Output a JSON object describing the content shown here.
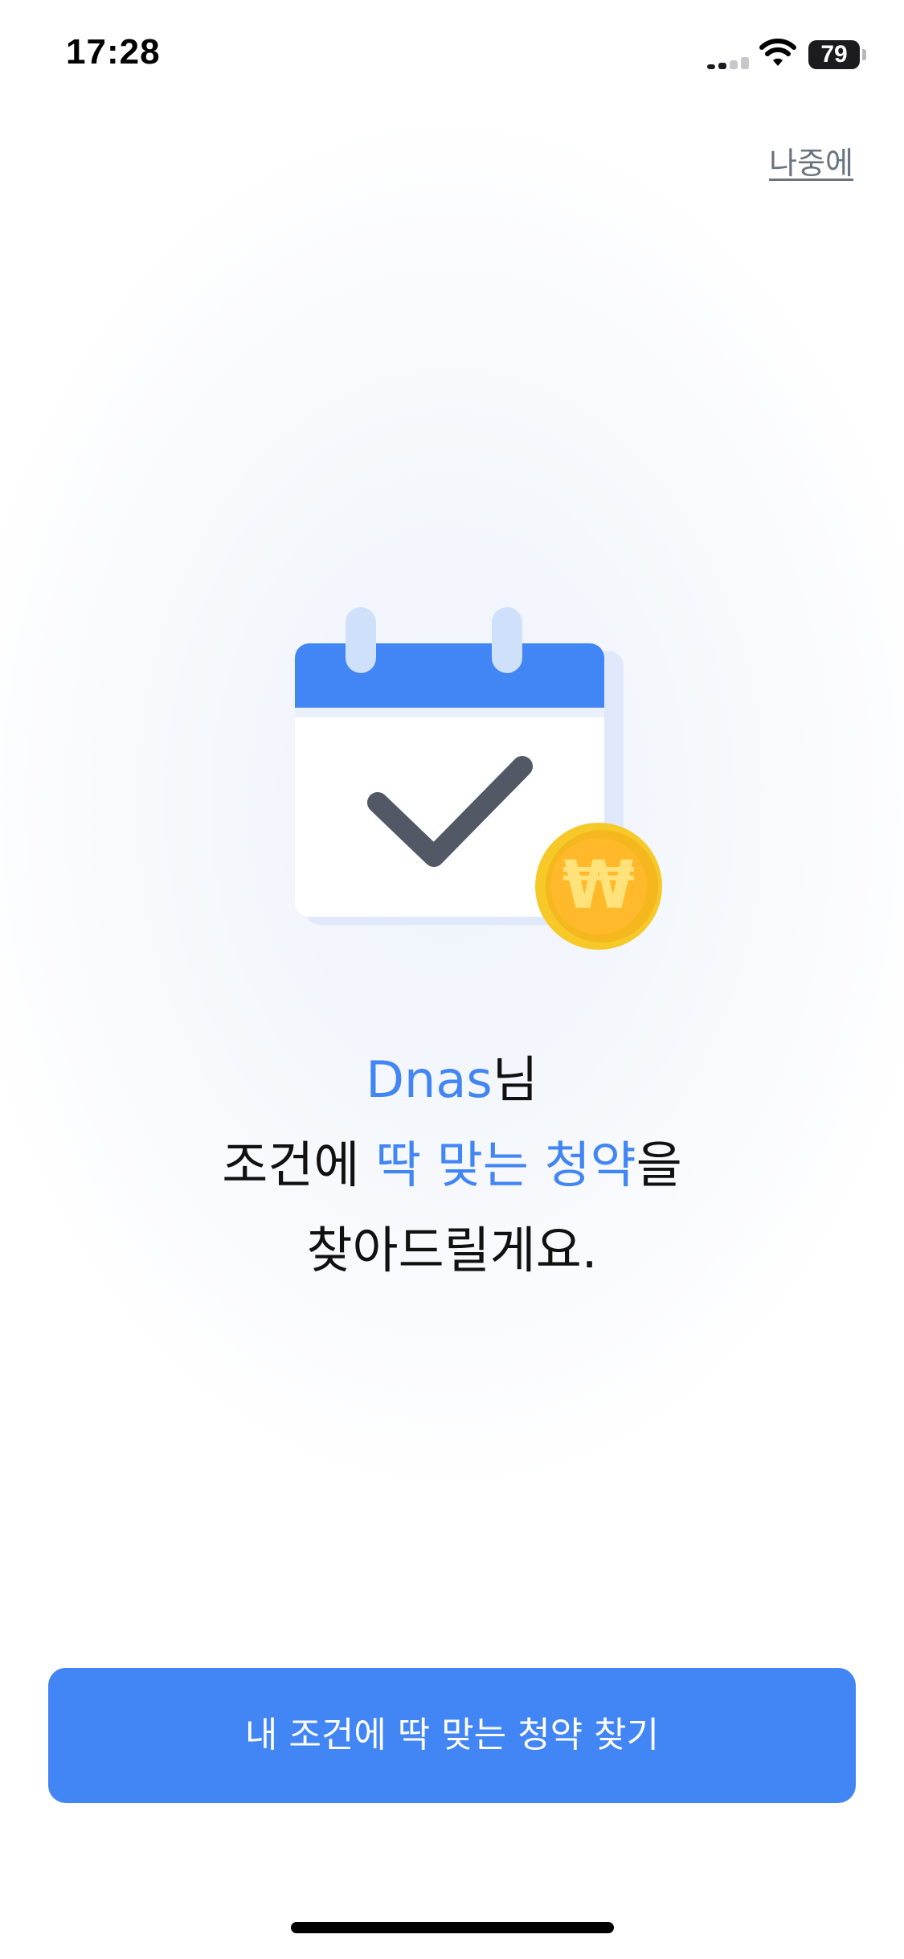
{
  "status_bar": {
    "time": "17:28",
    "battery_level": "79",
    "icons": [
      "cellular-signal-icon",
      "wifi-icon",
      "battery-icon"
    ]
  },
  "header": {
    "later_label": "나중에"
  },
  "illustration": {
    "icons": [
      "calendar-icon",
      "checkmark-icon",
      "won-coin-icon"
    ],
    "coin_symbol": "₩"
  },
  "headline": {
    "name": "Dnas",
    "name_suffix": "님",
    "line2_prefix": "조건에 ",
    "line2_accent": "딱 맞는 청약",
    "line2_suffix": "을",
    "line3": "찾아드릴게요."
  },
  "cta": {
    "label": "내 조건에 딱 맞는 청약 찾기"
  },
  "colors": {
    "accent": "#4285f4",
    "coin": "#f7c928",
    "check": "#525866"
  }
}
